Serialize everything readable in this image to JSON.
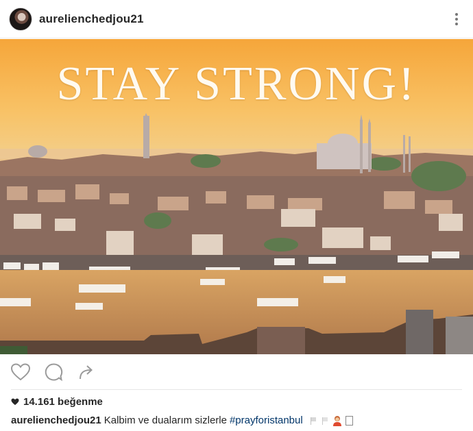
{
  "post": {
    "username": "aurelienchedjou21",
    "image_text": "STAY STRONG!",
    "likes": "14.161 beğenme",
    "caption": {
      "username": "aurelienchedjou21",
      "text": "Kalbim ve dualarım sizlerle",
      "hashtag": "#prayforistanbul"
    }
  },
  "icons": {
    "more": "more-vertical-icon",
    "like": "heart-outline-icon",
    "comment": "comment-bubble-icon",
    "share": "share-arrow-icon",
    "likes": "heart-filled-icon"
  },
  "colors": {
    "hashtag": "#003569",
    "sky": "#f8b64c",
    "text": "#262626"
  }
}
